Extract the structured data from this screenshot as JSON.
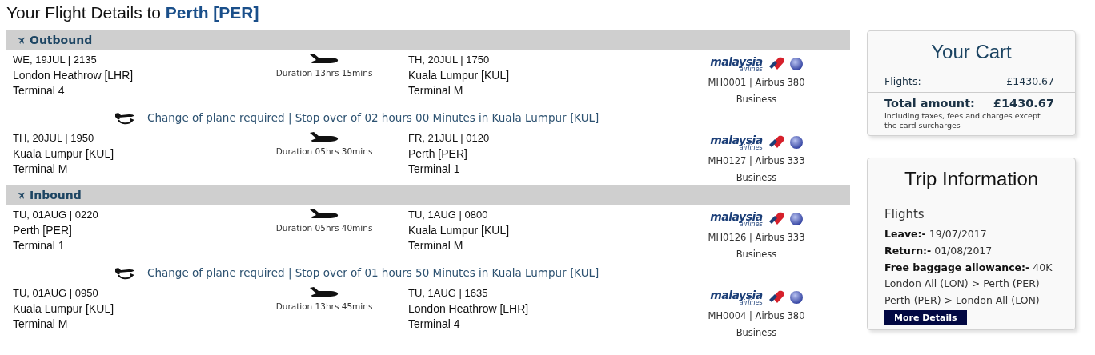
{
  "title": "Your Flight Details to **Perth [PER]**",
  "journeys": [
    {
      "label": "Outbound",
      "items": [
        {
          "kind": "leg",
          "departure": {
            "when": "WE, 19JUL | 2135",
            "place": "London Heathrow [LHR]",
            "terminal": "Terminal 4"
          },
          "duration": "Duration 13hrs 15mins",
          "arrival": {
            "when": "TH, 20JUL | 1750",
            "place": "Kuala Lumpur [KUL]",
            "terminal": "Terminal M"
          },
          "logo": "malaysia",
          "logo_sub": "airlines",
          "flight": "MH0001 | Airbus 380",
          "cabin": "Business"
        },
        {
          "kind": "stopover",
          "text": "Change of plane required | Stop over of 02 hours 00 Minutes in Kuala Lumpur [KUL]"
        },
        {
          "kind": "leg",
          "departure": {
            "when": "TH, 20JUL | 1950",
            "place": "Kuala Lumpur [KUL]",
            "terminal": "Terminal M"
          },
          "duration": "Duration 05hrs 30mins",
          "arrival": {
            "when": "FR, 21JUL | 0120",
            "place": "Perth [PER]",
            "terminal": "Terminal 1"
          },
          "logo": "malaysia",
          "logo_sub": "airlines",
          "flight": "MH0127 | Airbus 333",
          "cabin": "Business"
        }
      ]
    },
    {
      "label": "Inbound",
      "items": [
        {
          "kind": "leg",
          "departure": {
            "when": "TU, 01AUG | 0220",
            "place": "Perth [PER]",
            "terminal": "Terminal 1"
          },
          "duration": "Duration 05hrs 40mins",
          "arrival": {
            "when": "TU, 1AUG | 0800",
            "place": "Kuala Lumpur [KUL]",
            "terminal": "Terminal M"
          },
          "logo": "malaysia",
          "logo_sub": "airlines",
          "flight": "MH0126 | Airbus 333",
          "cabin": "Business"
        },
        {
          "kind": "stopover",
          "text": "Change of plane required | Stop over of 01 hours 50 Minutes in Kuala Lumpur [KUL]"
        },
        {
          "kind": "leg",
          "departure": {
            "when": "TU, 01AUG | 0950",
            "place": "Kuala Lumpur [KUL]",
            "terminal": "Terminal M"
          },
          "duration": "Duration 13hrs 45mins",
          "arrival": {
            "when": "TU, 1AUG | 1635",
            "place": "London Heathrow [LHR]",
            "terminal": "Terminal 4"
          },
          "logo": "malaysia",
          "logo_sub": "airlines",
          "flight": "MH0004 | Airbus 380",
          "cabin": "Business"
        }
      ]
    }
  ],
  "cart": {
    "title": "Your Cart",
    "rows": [
      {
        "label": "Flights:",
        "value": "£1430.67"
      }
    ],
    "total": {
      "label": "Total amount:",
      "value": "£1430.67",
      "note": "Including taxes, fees and charges except the card surcharges"
    }
  },
  "trip": {
    "title": "Trip Information",
    "heading": "Flights",
    "lines": [
      "**Leave:-** 19/07/2017",
      "**Return:-** 01/08/2017",
      "**Free baggage allowance:-** 40K",
      "London All (LON) > Perth (PER)",
      "Perth (PER) > London All (LON)"
    ],
    "button": "More Details"
  }
}
